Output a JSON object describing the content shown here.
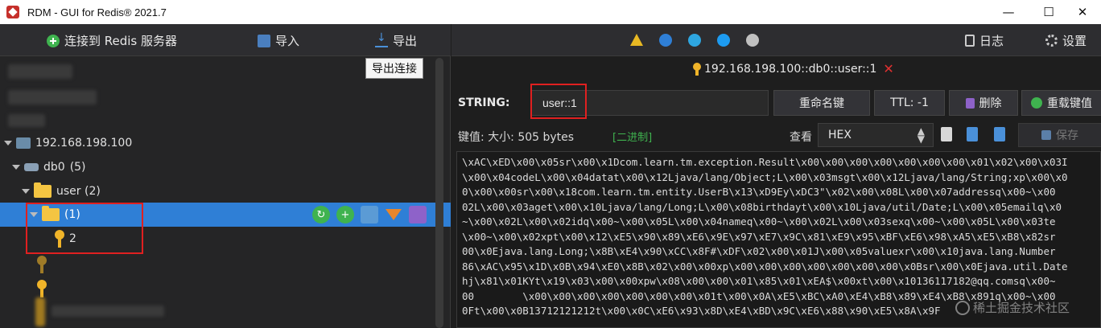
{
  "window": {
    "title": "RDM - GUI for Redis® 2021.7",
    "min": "—",
    "max": "☐",
    "close": "✕"
  },
  "left_toolbar": {
    "connect": "连接到 Redis 服务器",
    "import": "导入",
    "export": "导出",
    "tooltip": "导出连接"
  },
  "tree": {
    "server": "192.168.198.100",
    "db": "db0",
    "db_count": "(5)",
    "folder_user": "user (2)",
    "folder_sub": "(1)",
    "key": "2"
  },
  "right_toolbar": {
    "log": "日志",
    "settings": "设置"
  },
  "tab": {
    "label": "192.168.198.100::db0::user::1",
    "close": "✕"
  },
  "key_panel": {
    "type_label": "STRING:",
    "key_value": "user::1",
    "rename": "重命名键",
    "ttl": "TTL:  -1",
    "delete": "删除",
    "reload": "重载键值",
    "meta": "键值: 大小: 505 bytes",
    "binary": "[二进制]",
    "view_label": "查看",
    "view_mode": "HEX",
    "save": "保存"
  },
  "value_lines": [
    "\\xAC\\xED\\x00\\x05sr\\x00\\x1Dcom.learn.tm.exception.Result\\x00\\x00\\x00\\x00\\x00\\x00\\x00\\x01\\x02\\x00\\x03I",
    "\\x00\\x04codeL\\x00\\x04datat\\x00\\x12Ljava/lang/Object;L\\x00\\x03msgt\\x00\\x12Ljava/lang/String;xp\\x00\\x0",
    "0\\x00\\x00sr\\x00\\x18com.learn.tm.entity.UserB\\x13\\xD9Ey\\xDC3\"\\x02\\x00\\x08L\\x00\\x07addressq\\x00~\\x00",
    "02L\\x00\\x03aget\\x00\\x10Ljava/lang/Long;L\\x00\\x08birthdayt\\x00\\x10Ljava/util/Date;L\\x00\\x05emailq\\x0",
    "~\\x00\\x02L\\x00\\x02idq\\x00~\\x00\\x05L\\x00\\x04nameq\\x00~\\x00\\x02L\\x00\\x03sexq\\x00~\\x00\\x05L\\x00\\x03te",
    "\\x00~\\x00\\x02xpt\\x00\\x12\\xE5\\x90\\x89\\xE6\\x9E\\x97\\xE7\\x9C\\x81\\xE9\\x95\\xBF\\xE6\\x98\\xA5\\xE5\\xB8\\x82sr",
    "00\\x0Ejava.lang.Long;\\x8B\\xE4\\x90\\xCC\\x8F#\\xDF\\x02\\x00\\x01J\\x00\\x05valuexr\\x00\\x10java.lang.Number",
    "86\\xAC\\x95\\x1D\\x0B\\x94\\xE0\\x8B\\x02\\x00\\x00xp\\x00\\x00\\x00\\x00\\x00\\x00\\x00\\x0Bsr\\x00\\x0Ejava.util.Date",
    "hj\\x81\\x01KYt\\x19\\x03\\x00\\x00xpw\\x08\\x00\\x00\\x01\\x85\\x01\\xEA$\\x00xt\\x00\\x10136117182@qq.comsq\\x00~",
    "00        \\x00\\x00\\x00\\x00\\x00\\x00\\x00\\x01t\\x00\\x0A\\xE5\\xBC\\xA0\\xE4\\xB8\\x89\\xE4\\xB8\\x891q\\x00~\\x00",
    "0Ft\\x00\\x0B13712121212t\\x00\\x0C\\xE6\\x93\\x8D\\xE4\\xBD\\x9C\\xE6\\x88\\x90\\xE5\\x8A\\x9F"
  ],
  "watermark": "稀土掘金技术社区"
}
